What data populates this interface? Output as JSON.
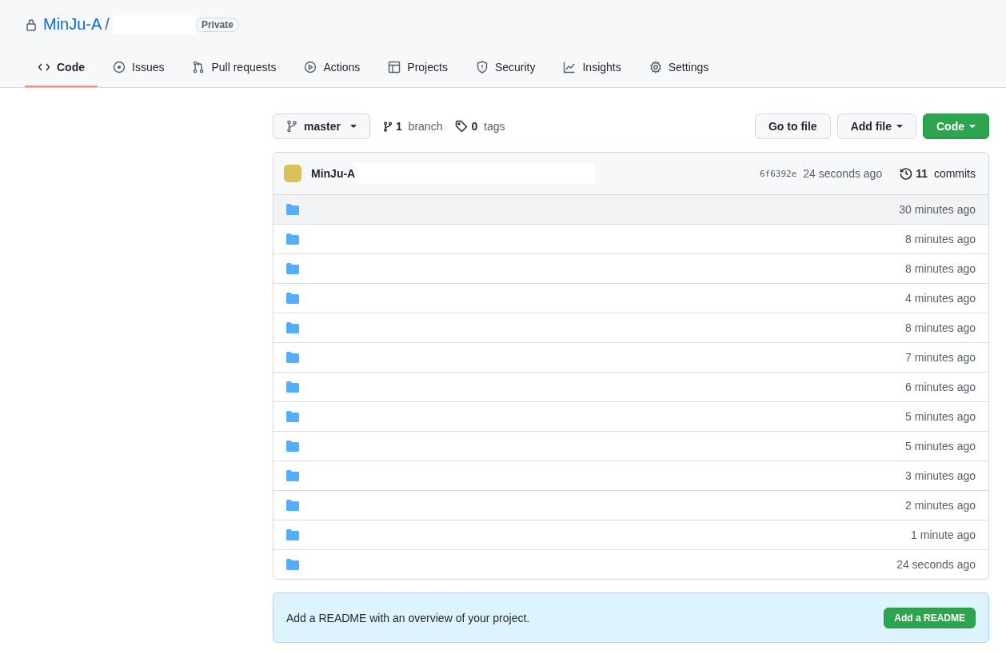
{
  "repo": {
    "owner": "MinJu-A",
    "separator": "/",
    "visibility": "Private"
  },
  "tabs": [
    {
      "label": "Code",
      "selected": true
    },
    {
      "label": "Issues",
      "selected": false
    },
    {
      "label": "Pull requests",
      "selected": false
    },
    {
      "label": "Actions",
      "selected": false
    },
    {
      "label": "Projects",
      "selected": false
    },
    {
      "label": "Security",
      "selected": false
    },
    {
      "label": "Insights",
      "selected": false
    },
    {
      "label": "Settings",
      "selected": false
    }
  ],
  "toolbar": {
    "branch_button": "master",
    "branch_count": "1",
    "branch_label": "branch",
    "tag_count": "0",
    "tag_label": "tags",
    "go_to_file": "Go to file",
    "add_file": "Add file",
    "code": "Code"
  },
  "commit": {
    "author": "MinJu-A",
    "sha": "6f6392e",
    "time": "24 seconds ago",
    "commit_count": "11",
    "commits_label": "commits"
  },
  "files": [
    {
      "time": "30 minutes ago",
      "highlighted": true
    },
    {
      "time": "8 minutes ago",
      "highlighted": false
    },
    {
      "time": "8 minutes ago",
      "highlighted": false
    },
    {
      "time": "4 minutes ago",
      "highlighted": false
    },
    {
      "time": "8 minutes ago",
      "highlighted": false
    },
    {
      "time": "7 minutes ago",
      "highlighted": false
    },
    {
      "time": "6 minutes ago",
      "highlighted": false
    },
    {
      "time": "5 minutes ago",
      "highlighted": false
    },
    {
      "time": "5 minutes ago",
      "highlighted": false
    },
    {
      "time": "3 minutes ago",
      "highlighted": false
    },
    {
      "time": "2 minutes ago",
      "highlighted": false
    },
    {
      "time": "1 minute ago",
      "highlighted": false
    },
    {
      "time": "24 seconds ago",
      "highlighted": false
    }
  ],
  "readme_banner": {
    "text": "Add a README with an overview of your project.",
    "button": "Add a README"
  }
}
